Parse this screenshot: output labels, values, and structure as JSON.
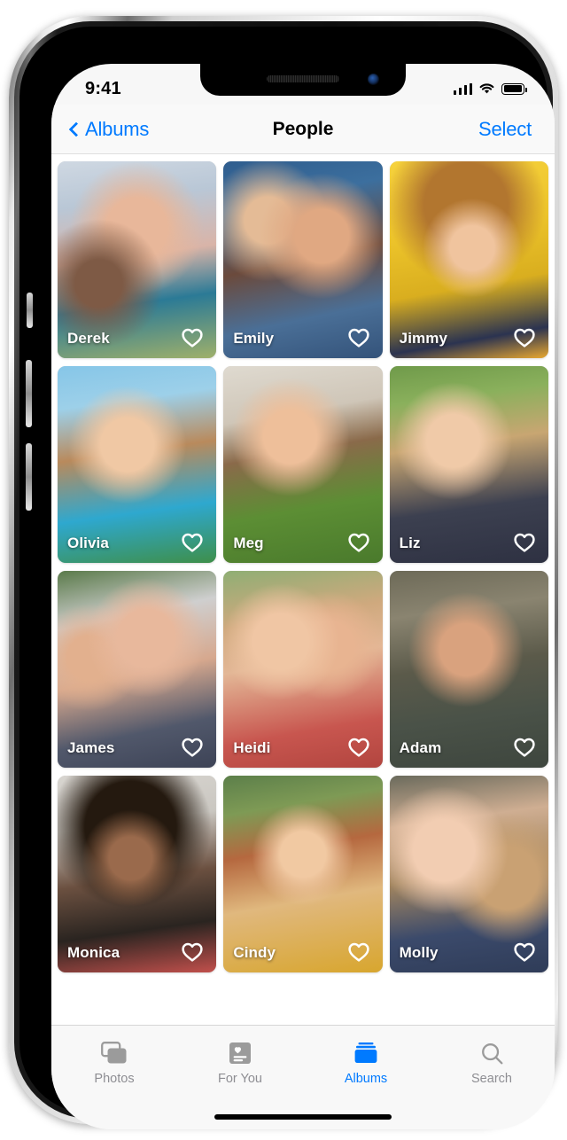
{
  "device": {
    "status_bar": {
      "time": "9:41",
      "signal_icon": "cellular-signal-icon",
      "wifi_icon": "wifi-icon",
      "battery_icon": "battery-full-icon"
    },
    "home_indicator": "home-indicator"
  },
  "navbar": {
    "back_label": "Albums",
    "back_icon": "chevron-left-icon",
    "title": "People",
    "action_label": "Select"
  },
  "accent_color": "#007AFF",
  "people": [
    {
      "name": "Derek",
      "favorite": false,
      "favorite_icon": "heart-outline-icon"
    },
    {
      "name": "Emily",
      "favorite": false,
      "favorite_icon": "heart-outline-icon"
    },
    {
      "name": "Jimmy",
      "favorite": false,
      "favorite_icon": "heart-outline-icon"
    },
    {
      "name": "Olivia",
      "favorite": false,
      "favorite_icon": "heart-outline-icon"
    },
    {
      "name": "Meg",
      "favorite": false,
      "favorite_icon": "heart-outline-icon"
    },
    {
      "name": "Liz",
      "favorite": false,
      "favorite_icon": "heart-outline-icon"
    },
    {
      "name": "James",
      "favorite": false,
      "favorite_icon": "heart-outline-icon"
    },
    {
      "name": "Heidi",
      "favorite": false,
      "favorite_icon": "heart-outline-icon"
    },
    {
      "name": "Adam",
      "favorite": false,
      "favorite_icon": "heart-outline-icon"
    },
    {
      "name": "Monica",
      "favorite": false,
      "favorite_icon": "heart-outline-icon"
    },
    {
      "name": "Cindy",
      "favorite": false,
      "favorite_icon": "heart-outline-icon"
    },
    {
      "name": "Molly",
      "favorite": false,
      "favorite_icon": "heart-outline-icon"
    }
  ],
  "tabbar": {
    "items": [
      {
        "label": "Photos",
        "icon": "photos-stack-icon",
        "active": false
      },
      {
        "label": "For You",
        "icon": "for-you-card-icon",
        "active": false
      },
      {
        "label": "Albums",
        "icon": "albums-stack-icon",
        "active": true
      },
      {
        "label": "Search",
        "icon": "search-icon",
        "active": false
      }
    ]
  }
}
